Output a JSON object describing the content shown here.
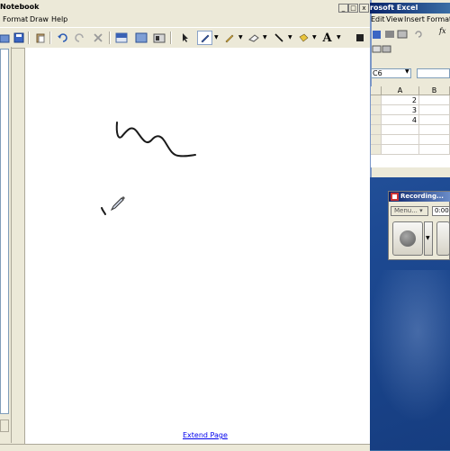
{
  "notebook": {
    "title": "Notebook",
    "menu": [
      "Format",
      "Draw",
      "Help"
    ],
    "window_buttons": [
      "_",
      "□",
      "x"
    ],
    "extend_link": "Extend Page",
    "tools": [
      "undo",
      "redo",
      "delete",
      "screen-shade",
      "full-screen",
      "dual-page",
      "select",
      "pen",
      "creative-pen",
      "eraser",
      "line",
      "fill",
      "text"
    ]
  },
  "excel": {
    "title": "rosoft Excel",
    "menu": [
      "Edit",
      "View",
      "Insert",
      "Format"
    ],
    "name_box": "C6",
    "fx_label": "fx",
    "columns": [
      "A",
      "B"
    ],
    "cells": [
      "2",
      "3",
      "4",
      "",
      "",
      ""
    ]
  },
  "recorder": {
    "title": "Recording...",
    "menu_label": "Menu...",
    "time": "0:00"
  },
  "colors": {
    "window_bg": "#ece9d8",
    "titlebar": "#0a246a",
    "link": "#0000ee",
    "desktop": "#2a57a0"
  }
}
